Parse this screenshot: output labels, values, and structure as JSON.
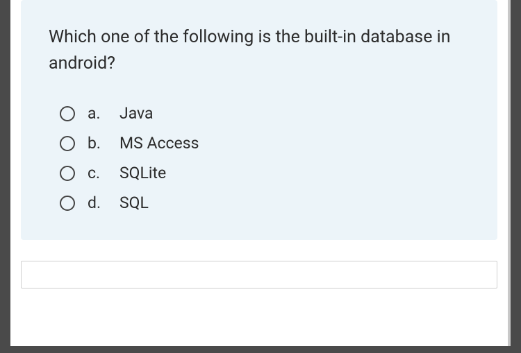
{
  "question": {
    "text": "Which one of the following is the built-in database in android?",
    "options": [
      {
        "letter": "a.",
        "label": "Java"
      },
      {
        "letter": "b.",
        "label": "MS Access"
      },
      {
        "letter": "c.",
        "label": "SQLite"
      },
      {
        "letter": "d.",
        "label": "SQL"
      }
    ]
  }
}
